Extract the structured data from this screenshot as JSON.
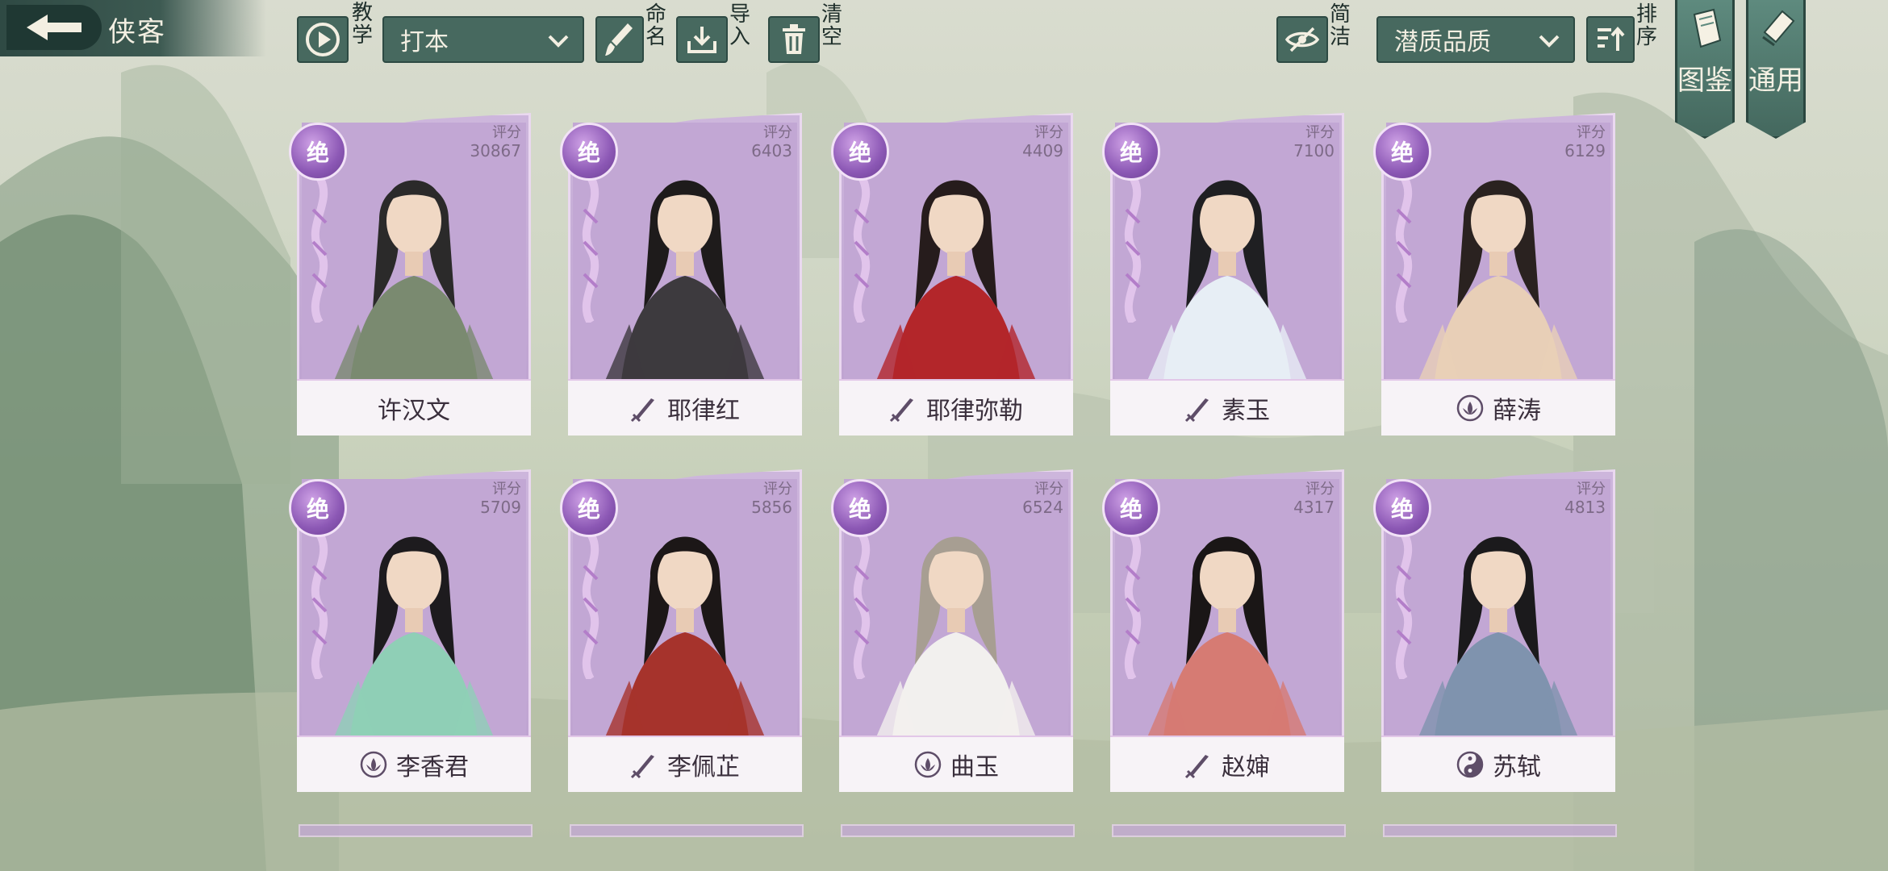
{
  "header": {
    "title": "侠客",
    "tutorial_label": "教学",
    "preset_value": "打本",
    "rename_label": "命名",
    "import_label": "导入",
    "clear_label": "清空",
    "simple_label": "简洁",
    "sort_value": "潜质品质",
    "sort_label": "排序"
  },
  "side_tabs": {
    "atlas_label": "图鉴",
    "general_label": "通用"
  },
  "rating_label": "评分",
  "heroes": [
    {
      "name": "许汉文",
      "grade": "绝",
      "rating": "30867",
      "icon": "none",
      "robe": "#7a8a70",
      "hair": "#2b2a2a"
    },
    {
      "name": "耶律红",
      "grade": "绝",
      "rating": "6403",
      "icon": "sword-icon",
      "robe": "#3d3a3e",
      "hair": "#1e1b1b"
    },
    {
      "name": "耶律弥勒",
      "grade": "绝",
      "rating": "4409",
      "icon": "sword-icon",
      "robe": "#b3262a",
      "hair": "#261c1c"
    },
    {
      "name": "素玉",
      "grade": "绝",
      "rating": "7100",
      "icon": "sword-icon",
      "robe": "#e7eef5",
      "hair": "#1f1f22"
    },
    {
      "name": "薛涛",
      "grade": "绝",
      "rating": "6129",
      "icon": "lotus-icon",
      "robe": "#e8cfb7",
      "hair": "#2a2220"
    },
    {
      "name": "李香君",
      "grade": "绝",
      "rating": "5709",
      "icon": "lotus-icon",
      "robe": "#8fcfb6",
      "hair": "#1d1b1e"
    },
    {
      "name": "李佩芷",
      "grade": "绝",
      "rating": "5856",
      "icon": "sword-icon",
      "robe": "#a6332c",
      "hair": "#1c1717"
    },
    {
      "name": "曲玉",
      "grade": "绝",
      "rating": "6524",
      "icon": "lotus-icon",
      "robe": "#f2f0ee",
      "hair": "#a79e92"
    },
    {
      "name": "赵婶",
      "grade": "绝",
      "rating": "4317",
      "icon": "sword-icon",
      "robe": "#d67b73",
      "hair": "#1a1616"
    },
    {
      "name": "苏轼",
      "grade": "绝",
      "rating": "4813",
      "icon": "taiji-icon",
      "robe": "#7f93ae",
      "hair": "#1b1a1c"
    }
  ],
  "colors": {
    "accent": "#47695f",
    "card": "#bda1d0",
    "badge": "#8c58b5"
  }
}
